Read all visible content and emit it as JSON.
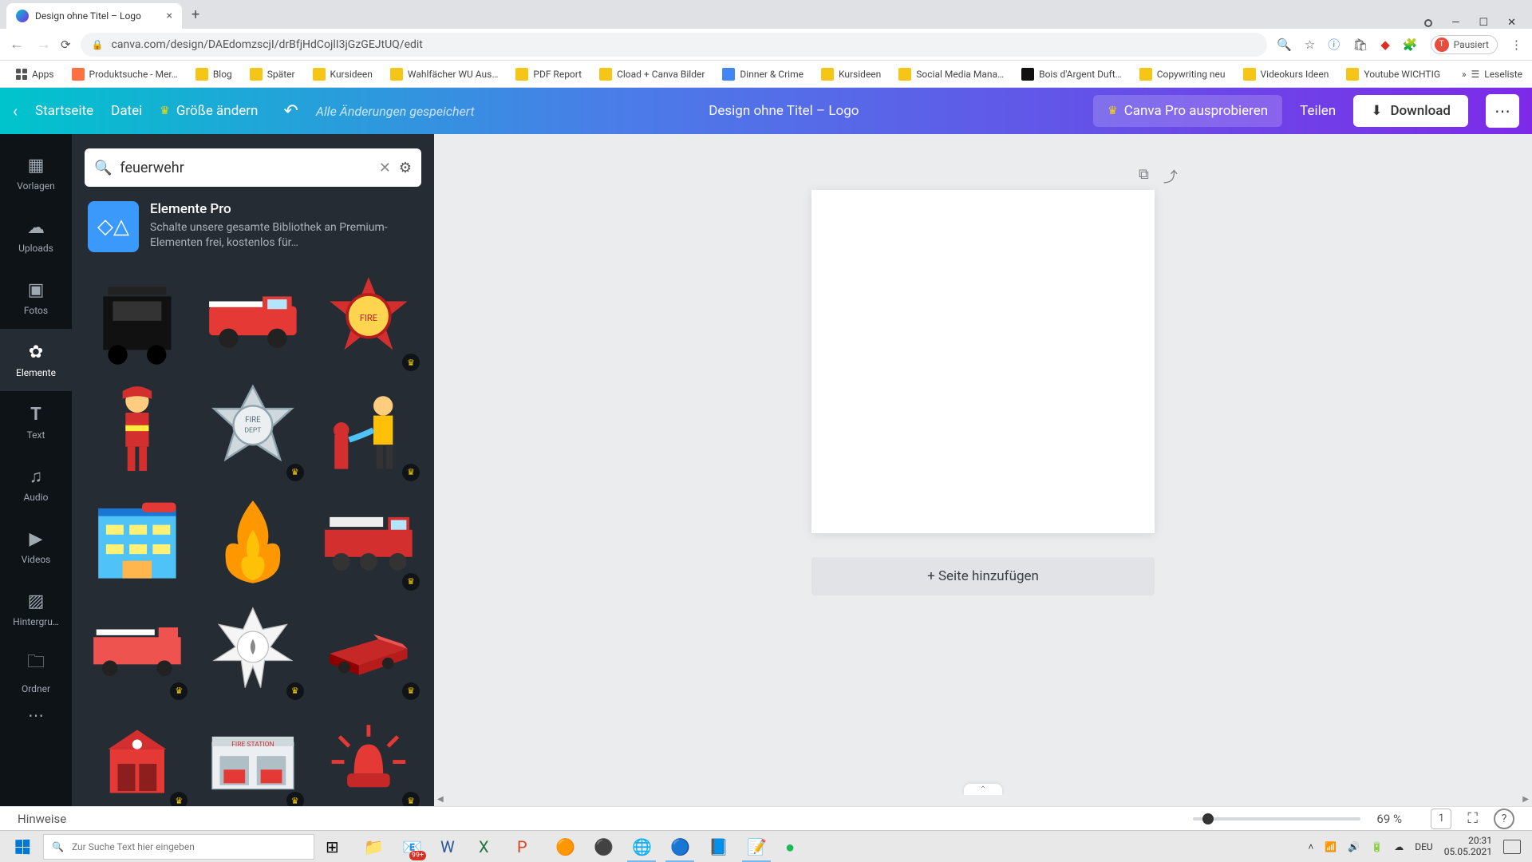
{
  "browser": {
    "tab_title": "Design ohne Titel – Logo",
    "url": "canva.com/design/DAEdomzscjI/drBfjHdCojlI3jGzGEJtUQ/edit",
    "user_status": "Pausiert",
    "user_initial": "T",
    "bookmarks": [
      {
        "label": "Apps",
        "icon": "apps"
      },
      {
        "label": "Produktsuche - Mer…",
        "icon": "orange"
      },
      {
        "label": "Blog",
        "icon": "yellow"
      },
      {
        "label": "Später",
        "icon": "yellow"
      },
      {
        "label": "Kursideen",
        "icon": "yellow"
      },
      {
        "label": "Wahlfächer WU Aus…",
        "icon": "yellow"
      },
      {
        "label": "PDF Report",
        "icon": "yellow"
      },
      {
        "label": "Cload + Canva Bilder",
        "icon": "yellow"
      },
      {
        "label": "Dinner & Crime",
        "icon": "blue"
      },
      {
        "label": "Kursideen",
        "icon": "yellow"
      },
      {
        "label": "Social Media Mana…",
        "icon": "yellow"
      },
      {
        "label": "Bois d'Argent Duft…",
        "icon": "dark"
      },
      {
        "label": "Copywriting neu",
        "icon": "yellow"
      },
      {
        "label": "Videokurs Ideen",
        "icon": "yellow"
      },
      {
        "label": "Youtube WICHTIG",
        "icon": "yellow"
      }
    ],
    "reading_list": "Leseliste"
  },
  "canva_bar": {
    "home": "Startseite",
    "file": "Datei",
    "resize": "Größe ändern",
    "saved": "Alle Änderungen gespeichert",
    "title": "Design ohne Titel – Logo",
    "try_pro": "Canva Pro ausprobieren",
    "share": "Teilen",
    "download": "Download"
  },
  "rail": [
    {
      "label": "Vorlagen",
      "icon": "▦"
    },
    {
      "label": "Uploads",
      "icon": "☁"
    },
    {
      "label": "Fotos",
      "icon": "▣"
    },
    {
      "label": "Elemente",
      "icon": "✿",
      "active": true
    },
    {
      "label": "Text",
      "icon": "T"
    },
    {
      "label": "Audio",
      "icon": "♫"
    },
    {
      "label": "Videos",
      "icon": "▶"
    },
    {
      "label": "Hintergru…",
      "icon": "▨"
    },
    {
      "label": "Ordner",
      "icon": "🗀"
    }
  ],
  "search": {
    "value": "feuerwehr",
    "placeholder": ""
  },
  "pro_promo": {
    "title": "Elemente Pro",
    "desc": "Schalte unsere gesamte Bibliothek an Premium-Elementen frei, kostenlos für…"
  },
  "elements": [
    {
      "name": "firetruck-front-dark",
      "crown": false
    },
    {
      "name": "firetruck-side-red",
      "crown": false
    },
    {
      "name": "fire-dept-badge-red",
      "crown": true
    },
    {
      "name": "firefighter-person",
      "crown": false
    },
    {
      "name": "fire-dept-badge-grey",
      "crown": true
    },
    {
      "name": "firefighter-hose-hydrant",
      "crown": true
    },
    {
      "name": "fire-station-building",
      "crown": false
    },
    {
      "name": "flame-orange",
      "crown": false
    },
    {
      "name": "firetruck-ladder",
      "crown": true
    },
    {
      "name": "firetruck-flat-red",
      "crown": true
    },
    {
      "name": "maltese-cross-white",
      "crown": true
    },
    {
      "name": "firetruck-isometric",
      "crown": true
    },
    {
      "name": "fire-station-house",
      "crown": true
    },
    {
      "name": "fire-station-garage",
      "crown": true
    },
    {
      "name": "siren-red",
      "crown": true
    }
  ],
  "canvas": {
    "add_page": "+ Seite hinzufügen"
  },
  "bottom": {
    "hinweise": "Hinweise",
    "zoom": "69 %",
    "page_count": "1"
  },
  "taskbar": {
    "search_placeholder": "Zur Suche Text hier eingeben",
    "lang": "DEU",
    "time": "20:31",
    "date": "05.05.2021"
  }
}
